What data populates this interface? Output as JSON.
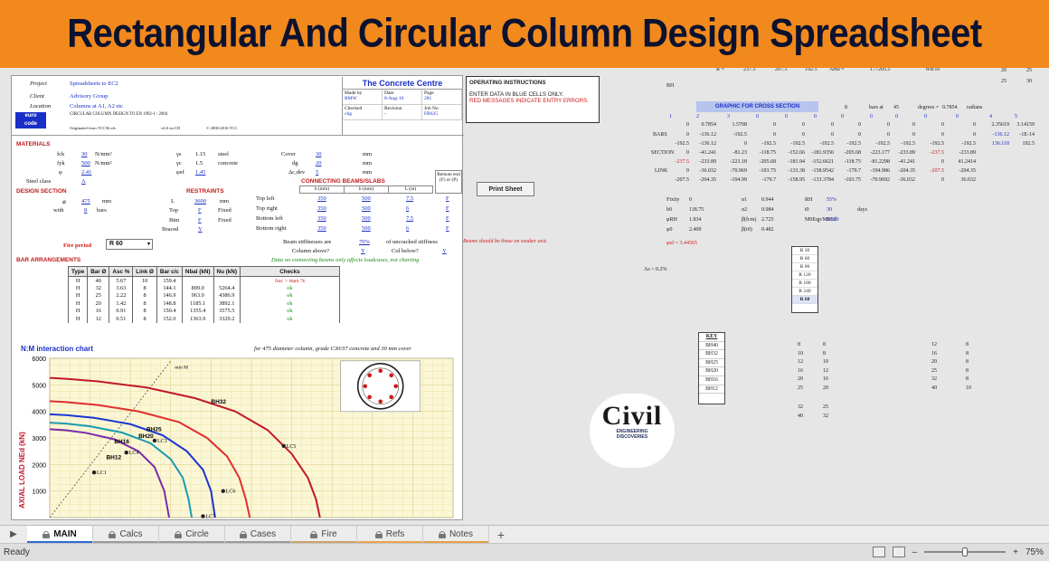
{
  "banner": {
    "title": "Rectangular And Circular Column Design Spreadsheet"
  },
  "header": {
    "labels": [
      "Project",
      "Client",
      "Location"
    ],
    "values": [
      "Spreadsheets to EC2",
      "Advisory Group",
      "Columns at A1, A2 etc"
    ],
    "subtitle": "CIRCULAR COLUMN DESIGN TO EN 1992-1 : 2004",
    "originated": "Originated from TCC56.xls",
    "version": "v4.0 on CD",
    "copyright": "© 2006-2016 TCC",
    "org": "The Concrete Centre",
    "made_by_label": "Made by",
    "date_label": "Date",
    "page_label": "Page",
    "made_by": "RMW",
    "date": "8-Aug-16",
    "page": "281",
    "checked_label": "Checked",
    "revision_label": "Revision",
    "job_label": "Job No",
    "checked": "chg",
    "revision": "-",
    "job": "FB625"
  },
  "materials": {
    "title": "MATERIALS",
    "fck_l": "fck",
    "fck": "30",
    "fck_u": "N/mm²",
    "fyk_l": "fyk",
    "fyk": "500",
    "fyk_u": "N/mm²",
    "phi_l": "φ",
    "phi": "2.41",
    "steel_l": "Steel class",
    "steel": "A",
    "gs_l": "γs",
    "gs": "1.15",
    "gs_t": "steel",
    "gc_l": "γc",
    "gc": "1.5",
    "gc_t": "concrete",
    "gcf_l": "φef",
    "gcf": "1.45",
    "cover_l": "Cover",
    "cover": "30",
    "cover_u": "mm",
    "dg_l": "dg",
    "dg": "20",
    "dg_u": "mm",
    "dl_l": "Δc,dev",
    "dl": "5",
    "dl_u": "mm"
  },
  "design": {
    "title": "DESIGN SECTION",
    "dia_l": "⌀",
    "dia": "475",
    "dia_u": "mm",
    "with_l": "with",
    "bars": "8",
    "bars_u": "bars"
  },
  "restraints": {
    "title": "RESTRAINTS",
    "L_l": "L",
    "L": "3600",
    "L_u": "mm",
    "top_l": "Top",
    "top": "F",
    "btm_l": "Btm",
    "btm": "F",
    "fixed": "Fixed",
    "braced_l": "Braced",
    "braced": "Y"
  },
  "beams": {
    "title": "CONNECTING BEAMS/SLABS",
    "cols": [
      "b (mm)",
      "h (mm)",
      "L (m)"
    ],
    "remote": "Remote end",
    "remote2": "(F) or (P)",
    "rows": [
      [
        "Top left",
        "350",
        "500",
        "7.5",
        "F"
      ],
      [
        "Top right",
        "350",
        "500",
        "6",
        "F"
      ],
      [
        "Bottom left",
        "350",
        "500",
        "7.5",
        "F"
      ],
      [
        "Bottom right",
        "350",
        "500",
        "6",
        "F"
      ]
    ]
  },
  "fire": {
    "label": "Fire period",
    "value": "R 60"
  },
  "stiffness": {
    "label": "Beam stiffnesses are",
    "value": "70%",
    "suffix": "of uncracked stiffness",
    "col_above_l": "Column above?",
    "col_above": "Y",
    "col_below_l": "Col below?",
    "col_below": "Y",
    "note": "Data on connecting beams only affects loadcases, not charting",
    "warn": "Beams should be those on weaker axis"
  },
  "bar_arrangements": {
    "title": "BAR ARRANGEMENTS",
    "headers": [
      "Type",
      "Bar Ø",
      "Asc %",
      "Link Ø",
      "Bar c/c",
      "Nbal (kN)",
      "Nu (kN)",
      "Checks"
    ],
    "rows": [
      [
        "H",
        "40",
        "5.67",
        "10",
        "159.4",
        "",
        "",
        "Asc > max %"
      ],
      [
        "H",
        "32",
        "3.63",
        "8",
        "144.1",
        "899.0",
        "5264.4",
        "ok"
      ],
      [
        "H",
        "25",
        "2.22",
        "8",
        "146.9",
        "963.0",
        "4386.9",
        "ok"
      ],
      [
        "H",
        "20",
        "1.42",
        "8",
        "148.8",
        "1185.1",
        "3892.1",
        "ok"
      ],
      [
        "H",
        "16",
        "0.91",
        "8",
        "150.4",
        "1355.4",
        "3575.5",
        "ok"
      ],
      [
        "H",
        "12",
        "0.51",
        "8",
        "152.0",
        "1363.9",
        "3329.2",
        "ok"
      ]
    ]
  },
  "chart_data": {
    "type": "line",
    "title": "N:M interaction chart",
    "note": "for 475 diameter column, grade C30/37 concrete and 30 mm cover",
    "ylabel": "AXIAL LOAD NEd (kN)",
    "ylim": [
      0,
      6000
    ],
    "yticks": [
      "6000",
      "5000",
      "4000",
      "3000",
      "2000",
      "1000"
    ],
    "xlim": [
      0,
      500
    ],
    "series": [
      {
        "name": "BH32",
        "color": "#c2182a",
        "x": [
          0,
          20,
          60,
          120,
          180,
          230,
          270,
          300,
          320,
          330,
          335
        ],
        "y": [
          5264,
          5230,
          5130,
          4900,
          4500,
          4000,
          3300,
          2400,
          1500,
          700,
          0
        ]
      },
      {
        "name": "BH25",
        "color": "#e02e2e",
        "x": [
          0,
          20,
          60,
          110,
          160,
          195,
          220,
          235,
          243,
          248
        ],
        "y": [
          4387,
          4350,
          4240,
          4000,
          3600,
          3000,
          2300,
          1500,
          700,
          0
        ]
      },
      {
        "name": "BH20",
        "color": "#1a36d0",
        "x": [
          0,
          20,
          55,
          100,
          140,
          170,
          190,
          200,
          205
        ],
        "y": [
          3892,
          3860,
          3760,
          3520,
          3100,
          2500,
          1800,
          1000,
          0
        ]
      },
      {
        "name": "BH16",
        "color": "#1a9ab2",
        "x": [
          0,
          20,
          50,
          90,
          125,
          150,
          165,
          172,
          176
        ],
        "y": [
          3576,
          3540,
          3440,
          3200,
          2800,
          2200,
          1500,
          700,
          0
        ]
      },
      {
        "name": "BH12",
        "color": "#7a2aa8",
        "x": [
          0,
          20,
          45,
          80,
          110,
          130,
          142,
          148
        ],
        "y": [
          3329,
          3290,
          3190,
          2950,
          2500,
          1900,
          1000,
          0
        ]
      }
    ],
    "points": [
      {
        "name": "LC1",
        "x": 55,
        "y": 1700
      },
      {
        "name": "LC3",
        "x": 130,
        "y": 2900
      },
      {
        "name": "LC4",
        "x": 95,
        "y": 2450
      },
      {
        "name": "LC5",
        "x": 290,
        "y": 2700
      },
      {
        "name": "LC6",
        "x": 215,
        "y": 1000
      },
      {
        "name": "LC7",
        "x": 190,
        "y": 50
      }
    ],
    "minM": {
      "label": "min M"
    }
  },
  "right": {
    "ops_title": "OPERATING INSTRUCTIONS",
    "ops_line1": "ENTER DATA IN BLUE CELLS ONLY.",
    "ops_line2": "RED MESSAGES INDICATE ENTRY ERRORS.",
    "print_btn": "Print Sheet",
    "r_row": [
      "R =",
      "237.5",
      "207.5",
      "192.5",
      "Area =",
      "177205.5",
      "8/8/16"
    ],
    "gfx_title": "GRAPHIC FOR CROSS SECTION",
    "gfx_side": [
      "8",
      "bars at",
      "45",
      "degrees =",
      "0.7854",
      "radians"
    ],
    "idx": [
      "1",
      "2",
      "3",
      "0",
      "0",
      "0",
      "0",
      "0",
      "0",
      "0",
      "0",
      "4",
      "5"
    ],
    "rads": [
      "0",
      "0.7854",
      "1.5708",
      "0",
      "0",
      "0",
      "0",
      "0",
      "0",
      "0",
      "0",
      "2.35619",
      "3.14159"
    ],
    "bars_l": "BARS",
    "bars_row": [
      "0",
      "-136.12",
      "-192.5",
      "0",
      "0",
      "0",
      "0",
      "0",
      "0",
      "0",
      "0",
      "-136.12",
      "-1E-14"
    ],
    "bars_row2": [
      "-192.5",
      "-136.12",
      "0",
      "-192.5",
      "-192.5",
      "-192.5",
      "-192.5",
      "-192.5",
      "-192.5",
      "-192.5",
      "-192.5",
      "136.118",
      "192.5"
    ],
    "section_l": "SECTION",
    "sec_row": [
      "0",
      "-41.241",
      "-81.23",
      "-118.75",
      "-152.66",
      "-181.9356",
      "-205.68",
      "-223.177",
      "-233.89",
      "-237.5",
      "-233.89"
    ],
    "sec_row2": [
      "-237.5",
      "-233.89",
      "-223.18",
      "-205.68",
      "-181.94",
      "-152.6621",
      "-118.75",
      "-81.2298",
      "-41.241",
      "0",
      "41.2414"
    ],
    "link_l": "LINK",
    "link_row": [
      "0",
      "-36.032",
      "-70.969",
      "-103.75",
      "-133.38",
      "-158.9542",
      "-179.7",
      "-194.986",
      "-204.35",
      "-207.5",
      "-204.35"
    ],
    "link_row2": [
      "-207.5",
      "-204.35",
      "-194.99",
      "-179.7",
      "-158.95",
      "-133.3784",
      "-103.75",
      "-70.9692",
      "-36.032",
      "0",
      "36.032"
    ],
    "fixity": [
      [
        "Fixity",
        "0",
        "α1",
        "0.944",
        "RH",
        "55%"
      ],
      [
        "h0",
        "118.75",
        "α2",
        "0.984",
        "t0",
        "30",
        "days"
      ],
      [
        "φRH",
        "1.834",
        "β(fcm)",
        "2.725",
        "M0Eqp/M0Ed",
        "0.600"
      ],
      [
        "φ0",
        "2.409",
        "β(t0)",
        "0.482"
      ]
    ],
    "phi_ef": "φef = 3.44565",
    "as_note": "As < 0.2%",
    "fire_list": [
      "R 30",
      "R 60",
      "R 90",
      "R 120",
      "R 180",
      "R 240",
      "R 60"
    ],
    "key_title": "KEY",
    "key": [
      "BH40",
      "BH32",
      "BH25",
      "BH20",
      "BH16",
      "BH12"
    ],
    "key_vals": [
      [
        "8",
        "8"
      ],
      [
        "10",
        "8"
      ],
      [
        "12",
        "10"
      ],
      [
        "16",
        "12"
      ],
      [
        "20",
        "16"
      ],
      [
        "25",
        "20"
      ]
    ],
    "key_vals2": [
      [
        "12",
        "8"
      ],
      [
        "16",
        "8"
      ],
      [
        "20",
        "8"
      ],
      [
        "25",
        "8"
      ],
      [
        "32",
        "8"
      ],
      [
        "40",
        "10"
      ]
    ],
    "key_extra": [
      [
        "32",
        "25"
      ],
      [
        "40",
        "32"
      ]
    ],
    "top_right": [
      "20",
      "25",
      "25",
      "30"
    ],
    "bh_l": "BH"
  },
  "logo": {
    "text": "Civil",
    "sub1": "ENGINEERING",
    "sub2": "DISCOVERIES"
  },
  "tabs": [
    {
      "label": "MAIN",
      "color": "#2e6bd6"
    },
    {
      "label": "Calcs",
      "color": "#9b9b9b"
    },
    {
      "label": "Circle",
      "color": "#9b9b9b"
    },
    {
      "label": "Cases",
      "color": "#9b9b9b"
    },
    {
      "label": "Fire",
      "color": "#c8a36a"
    },
    {
      "label": "Refs",
      "color": "#e8a54b"
    },
    {
      "label": "Notes",
      "color": "#e3a04a"
    }
  ],
  "status": {
    "ready": "Ready",
    "zoom": "75%"
  }
}
